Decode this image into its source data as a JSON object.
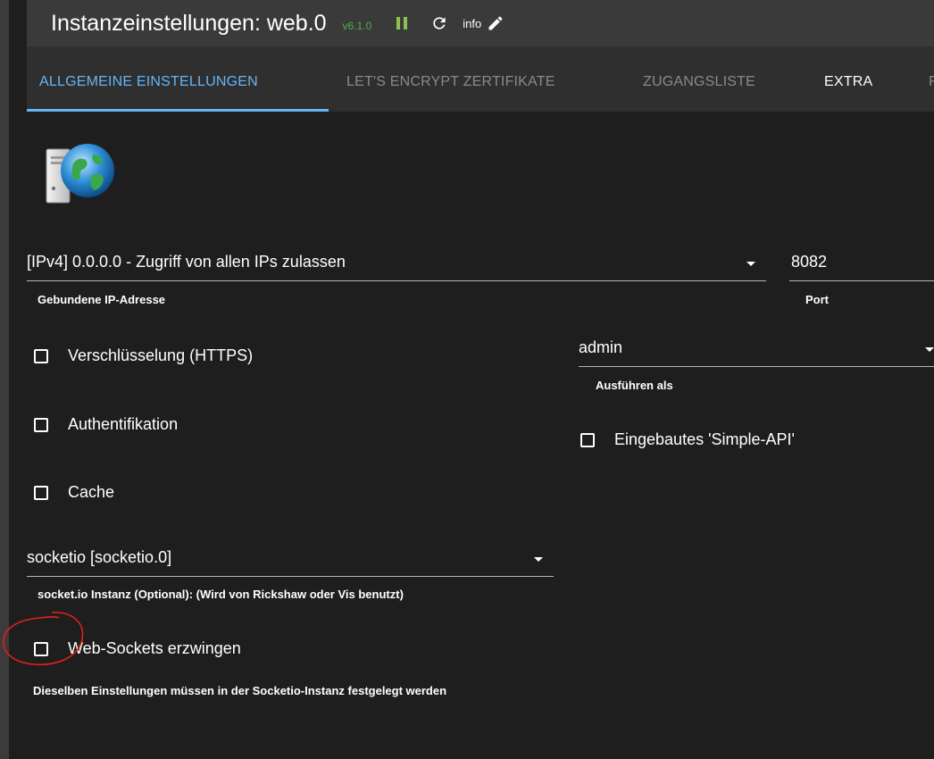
{
  "header": {
    "title": "Instanzeinstellungen: web.0",
    "version": "v6.1.0",
    "info_label": "info"
  },
  "tabs": [
    {
      "label": "ALLGEMEINE EINSTELLUNGEN",
      "active": true
    },
    {
      "label": "LET'S ENCRYPT ZERTIFIKATE",
      "active": false
    },
    {
      "label": "ZUGANGSLISTE",
      "active": false
    },
    {
      "label": "EXTRA",
      "active": false
    },
    {
      "label": "F",
      "active": false
    }
  ],
  "form": {
    "bind_ip": {
      "value": "[IPv4] 0.0.0.0 - Zugriff von allen IPs zulassen",
      "helper": "Gebundene IP-Adresse"
    },
    "port": {
      "value": "8082",
      "helper": "Port"
    },
    "run_as": {
      "value": "admin",
      "helper": "Ausführen als"
    },
    "https": {
      "label": "Verschlüsselung (HTTPS)",
      "checked": false
    },
    "auth": {
      "label": "Authentifikation",
      "checked": false
    },
    "simple_api": {
      "label": "Eingebautes 'Simple-API'",
      "checked": false
    },
    "cache": {
      "label": "Cache",
      "checked": false
    },
    "socketio": {
      "value": "socketio [socketio.0]",
      "helper": "socket.io Instanz (Optional): (Wird von Rickshaw oder Vis benutzt)"
    },
    "force_websockets": {
      "label": "Web-Sockets erzwingen",
      "checked": false
    },
    "note": "Dieselben Einstellungen müssen in der Socketio-Instanz festgelegt werden"
  },
  "colors": {
    "accent": "#64b5f6",
    "version_green": "#4caf50",
    "pause_green": "#8bc34a",
    "annotation_red": "#e0201c"
  },
  "icons": [
    "pause-icon",
    "reload-icon",
    "pencil-icon",
    "server-globe-icon",
    "chevron-down-icon"
  ]
}
